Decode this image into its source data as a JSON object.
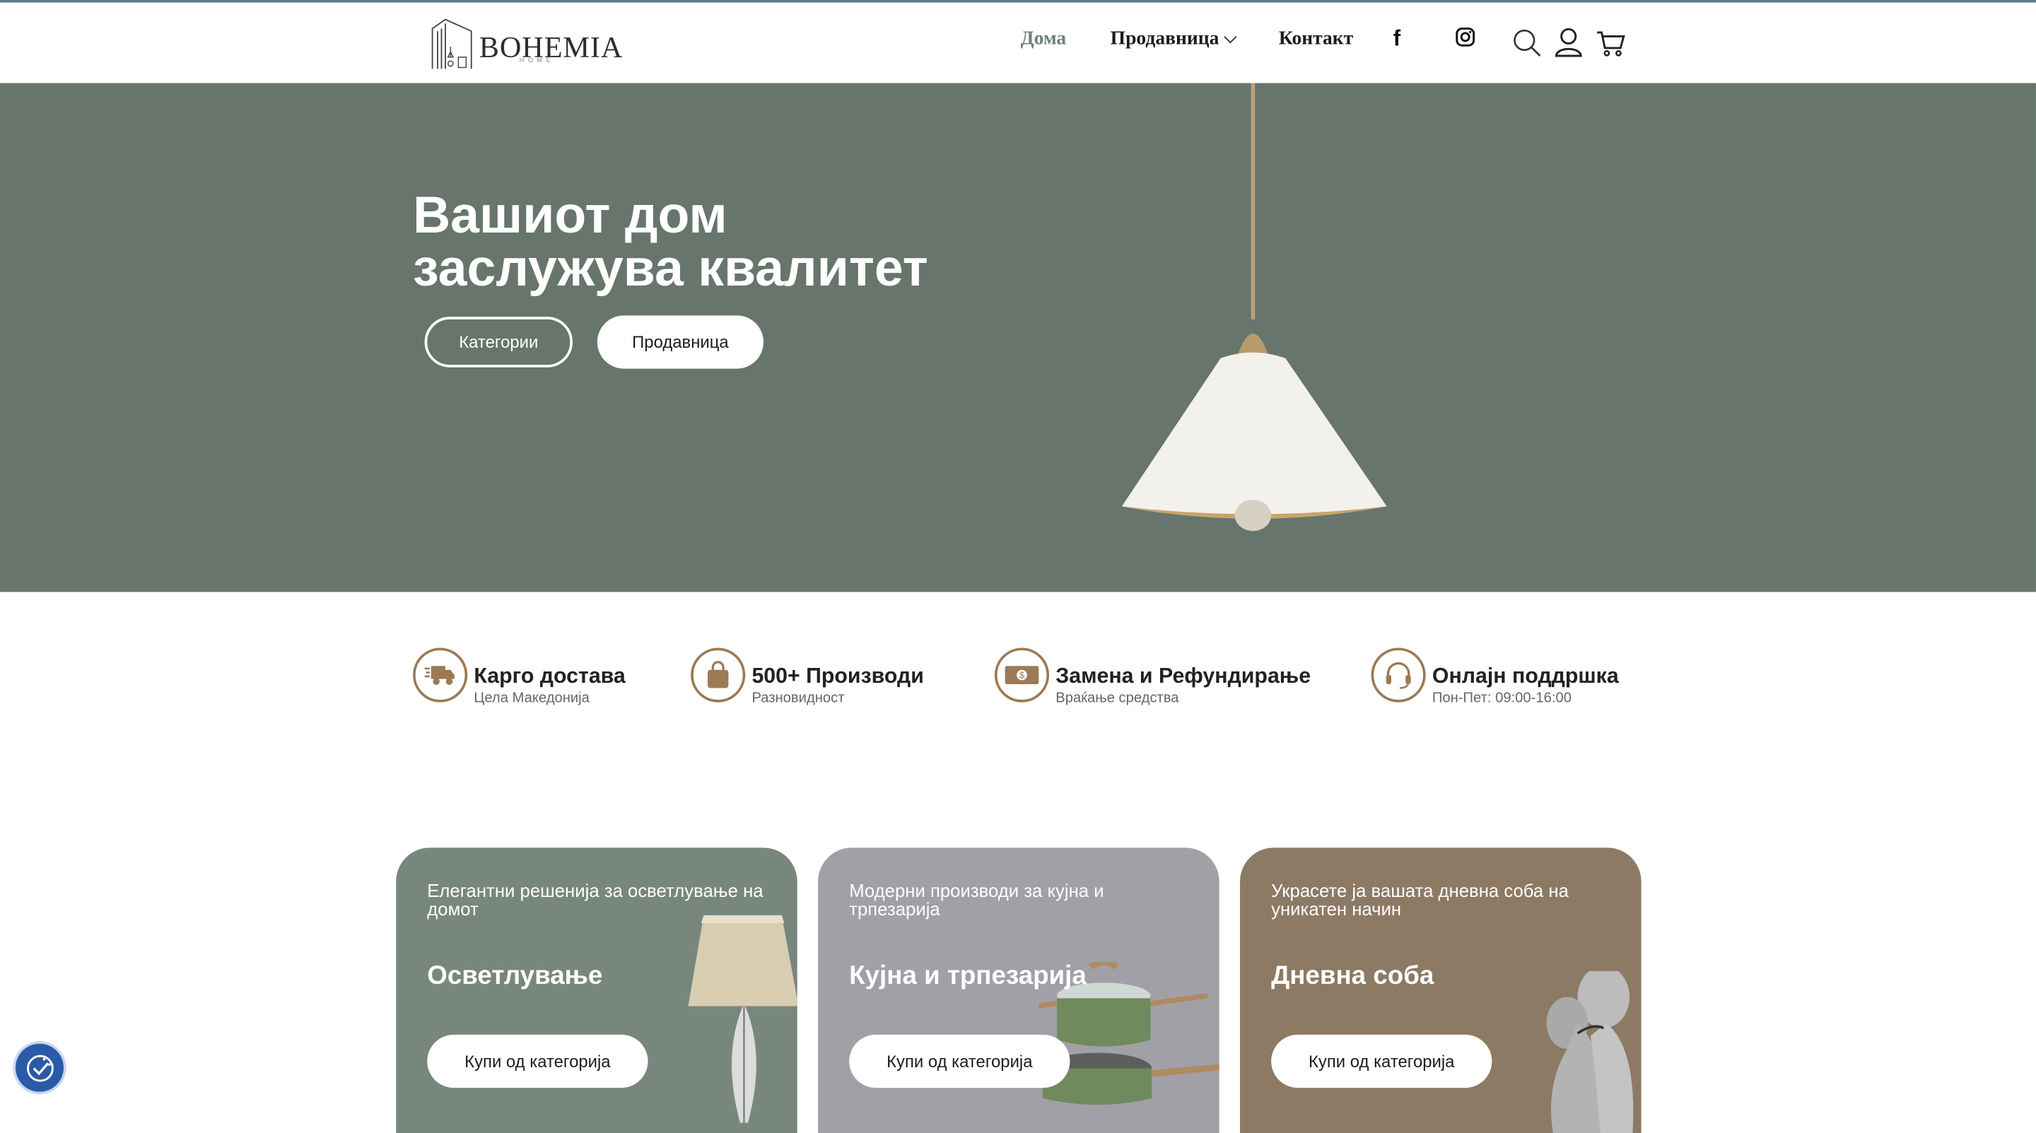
{
  "brand": {
    "name": "BOHEMIA",
    "sub": "HOME"
  },
  "nav": {
    "home": "Дома",
    "shop": "Продавница",
    "contact": "Контакт"
  },
  "header_icons": [
    "facebook-icon",
    "instagram-icon",
    "search-icon",
    "user-icon",
    "cart-icon"
  ],
  "hero": {
    "title_line1": "Вашиот дом",
    "title_line2": "заслужува квалитет",
    "btn_categories": "Категории",
    "btn_shop": "Продавница"
  },
  "features": [
    {
      "title": "Карго достава",
      "sub": "Цела Македонија",
      "icon": "truck-icon"
    },
    {
      "title": "500+ Производи",
      "sub": "Разновидност",
      "icon": "bag-icon"
    },
    {
      "title": "Замена и Рефундирање",
      "sub": "Враќање средства",
      "icon": "money-icon"
    },
    {
      "title": "Онлајн поддршка",
      "sub": "Пон-Пет: 09:00-16:00",
      "icon": "headset-icon"
    }
  ],
  "categories": [
    {
      "desc": "Елегантни решенија за осветлување на домот",
      "title": "Осветлување",
      "button": "Купи од категорија"
    },
    {
      "desc": "Модерни производи за кујна и трпезарија",
      "title": "Кујна и трпезарија",
      "button": "Купи од категорија"
    },
    {
      "desc": "Украсете ја вашата дневна соба на уникатен начин",
      "title": "Дневна соба",
      "button": "Купи од категорија"
    }
  ],
  "colors": {
    "hero_bg": "#67756c",
    "accent_brown": "#9b7a55",
    "card1": "#78877e",
    "card2": "#a0a0a6",
    "card3": "#8c7a64"
  }
}
